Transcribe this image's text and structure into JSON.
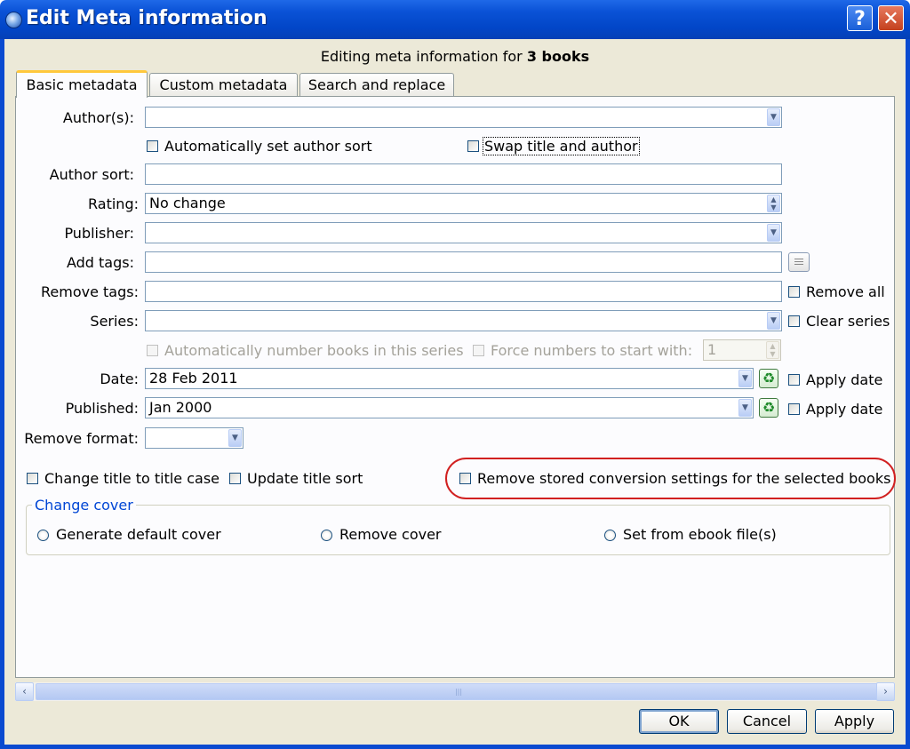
{
  "window": {
    "title": "Edit Meta information",
    "help_label": "?",
    "close_label": "✕",
    "subtitle_prefix": "Editing meta information for",
    "subtitle_count": "3 books"
  },
  "tabs": [
    {
      "label": "Basic metadata",
      "active": true
    },
    {
      "label": "Custom metadata",
      "active": false
    },
    {
      "label": "Search and replace",
      "active": false
    }
  ],
  "form": {
    "authors_label": "Author(s):",
    "authors_value": "",
    "auto_author_sort_label": "Automatically set author sort",
    "swap_title_author_label": "Swap title and author",
    "author_sort_label": "Author sort:",
    "author_sort_value": "",
    "rating_label": "Rating:",
    "rating_value": "No change",
    "publisher_label": "Publisher:",
    "publisher_value": "",
    "add_tags_label": "Add tags:",
    "add_tags_value": "",
    "remove_tags_label": "Remove tags:",
    "remove_tags_value": "",
    "remove_all_label": "Remove all",
    "series_label": "Series:",
    "series_value": "",
    "clear_series_label": "Clear series",
    "auto_number_label": "Automatically number books in this series",
    "force_numbers_label": "Force numbers to start with:",
    "force_numbers_value": "1",
    "date_label": "Date:",
    "date_value": "28 Feb 2011",
    "apply_date_label": "Apply date",
    "published_label": "Published:",
    "published_value": "Jan 2000",
    "apply_pubdate_label": "Apply date",
    "remove_format_label": "Remove format:",
    "remove_format_value": "",
    "title_case_label": "Change title to title case",
    "update_title_sort_label": "Update title sort",
    "remove_conversion_label": "Remove stored conversion settings for the selected books"
  },
  "cover": {
    "group_title": "Change cover",
    "generate_label": "Generate default cover",
    "remove_label": "Remove cover",
    "from_ebook_label": "Set from ebook file(s)"
  },
  "buttons": {
    "ok": "OK",
    "cancel": "Cancel",
    "apply": "Apply"
  },
  "icons": {
    "dropdown": "chevron-down-icon",
    "recycle": "recycle-icon",
    "tag_editor": "tag-list-icon"
  },
  "colors": {
    "titlebar": "#0a52d6",
    "dialog_bg": "#ece9d8",
    "highlight_circle": "#d12020",
    "group_title": "#0046d5"
  }
}
